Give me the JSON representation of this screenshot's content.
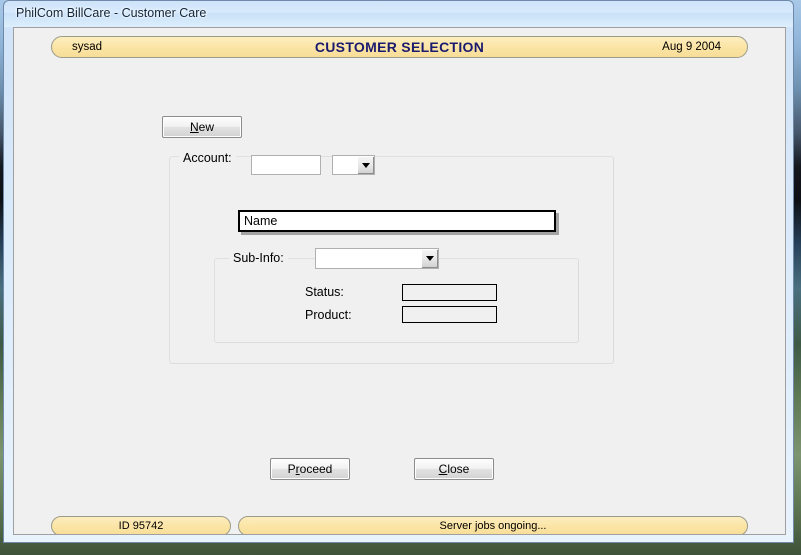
{
  "window": {
    "title": "PhilCom BillCare - Customer Care"
  },
  "banner": {
    "user": "sysad",
    "title": "CUSTOMER SELECTION",
    "date": "Aug 9 2004"
  },
  "toolbar": {
    "new_label": "New",
    "new_accel": "N"
  },
  "form": {
    "account_group_label": "Account:",
    "account_value": "",
    "account_placeholder": "",
    "account_combo_value": "",
    "name_value": "Name",
    "subinfo_group_label": "Sub-Info:",
    "subinfo_combo_value": "",
    "status_label": "Status:",
    "status_value": "",
    "product_label": "Product:",
    "product_value": ""
  },
  "actions": {
    "proceed_label": "Proceed",
    "close_label": "Close"
  },
  "statusbar": {
    "id_text": "ID 95742",
    "jobs_text": "Server jobs ongoing..."
  },
  "colors": {
    "banner_fill": "#fbe4a4",
    "banner_title": "#1a1a6e",
    "client_bg": "#f0f0f0",
    "titlebar": "#d7e9fc"
  },
  "icons": {
    "account_dropdown": "chevron-down-icon",
    "subinfo_dropdown": "chevron-down-icon"
  }
}
